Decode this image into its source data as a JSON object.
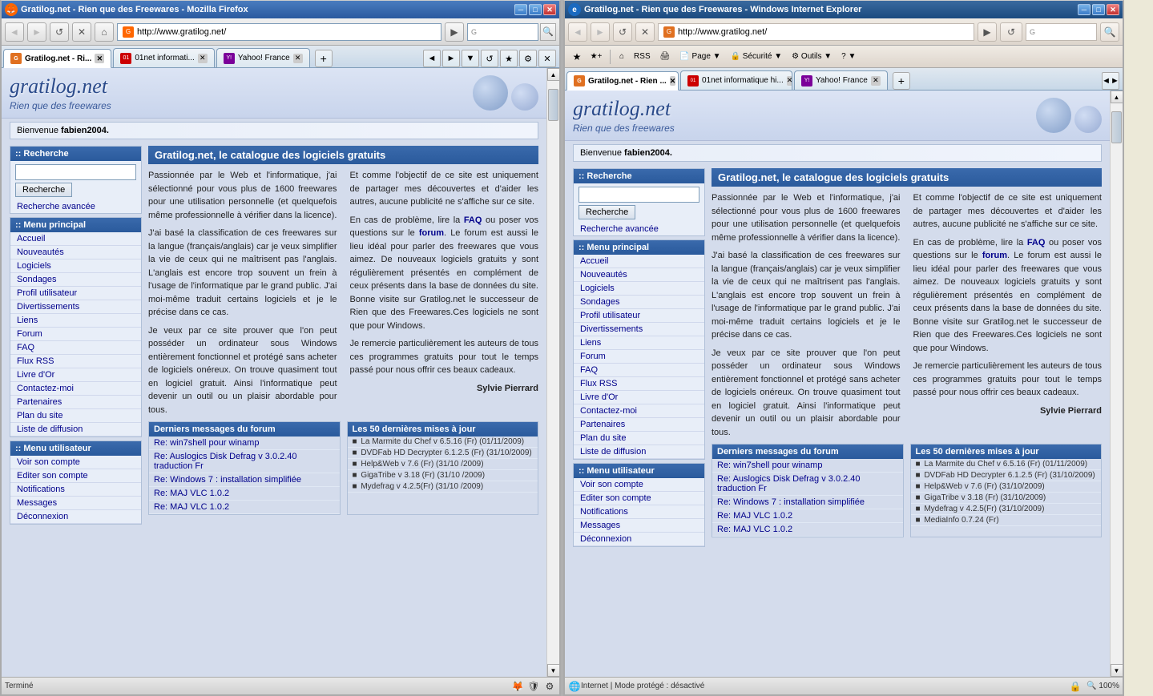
{
  "browsers": [
    {
      "id": "firefox",
      "title": "Gratilog.net - Rien que des Freewares - Mozilla Firefox",
      "type": "firefox",
      "nav": {
        "url": "http://www.gratilog.net/",
        "search_placeholder": "Google"
      },
      "tabs": [
        {
          "id": "tab1",
          "label": "Gratilog.net - Ri...",
          "active": true,
          "favicon_type": "gratilog"
        },
        {
          "id": "tab2",
          "label": "01net informati...",
          "active": false,
          "favicon_type": "zero1"
        },
        {
          "id": "tab3",
          "label": "Yahoo! France",
          "active": false,
          "favicon_type": "yahoo"
        }
      ],
      "status": "Terminé",
      "page": {
        "welcome": "Bienvenue ",
        "welcome_user": "fabien2004.",
        "search_section": ":: Recherche",
        "search_btn": "Recherche",
        "advanced_search": "Recherche avancée",
        "menu_title": ":: Menu principal",
        "menu_items": [
          "Accueil",
          "Nouveautés",
          "Logiciels",
          "Sondages",
          "Profil utilisateur",
          "Divertissements",
          "Liens",
          "Forum",
          "FAQ",
          "Flux RSS",
          "Livre d'Or",
          "Contactez-moi",
          "Partenaires",
          "Plan du site",
          "Liste de diffusion"
        ],
        "user_menu_title": ":: Menu utilisateur",
        "user_menu_items": [
          "Voir son compte",
          "Editer son compte",
          "Notifications",
          "Messages",
          "Déconnexion"
        ],
        "main_title": "Gratilog.net, le catalogue des logiciels gratuits",
        "main_text_col1": "Passionnée par le Web et l'informatique, j'ai sélectionné pour vous plus de 1600 freewares pour une utilisation personnelle (et quelquefois même professionnelle à vérifier dans la licence).\n\nJ'ai basé la classification de ces freewares sur la langue (français/anglais) car je veux simplifier la vie de ceux qui ne maîtrisent pas l'anglais. L'anglais est encore trop souvent un frein à l'usage de l'informatique par le grand public. J'ai moi-même traduit certains logiciels et je le précise dans ce cas.\n\nJe veux par ce site prouver que l'on peut posséder un ordinateur sous Windows entièrement fonctionnel et protégé sans acheter de logiciels onéreux. On trouve quasiment tout en logiciel gratuit. Ainsi l'informatique peut devenir un outil ou un plaisir abordable pour tous.",
        "main_text_col2": "Et comme l'objectif de ce site est uniquement de partager mes découvertes et d'aider les autres, aucune publicité ne s'affiche sur ce site.\n\nEn cas de problème, lire la FAQ ou poser vos questions sur le forum. Le forum est aussi le lieu idéal pour parler des freewares que vous aimez. De nouveaux logiciels gratuits y sont régulièrement présentés en complément de ceux présents dans la base de données du site. Bonne visite sur Gratilog.net le successeur de Rien que des Freewares.Ces logiciels ne sont que pour Windows.\n\nJe remercie particulièrement les auteurs de tous ces programmes gratuits pour tout le temps passé pour nous offrir ces beaux cadeaux.\n\nSylvie Pierrard",
        "forum_title": "Derniers messages du forum",
        "forum_items": [
          "Re: win7shell pour winamp",
          "Re: Auslogics Disk Defrag v 3.0.2.40 traduction Fr",
          "Re: Windows 7 : installation simplifiée",
          "Re: MAJ VLC 1.0.2",
          "Re: MAJ VLC 1.0.2"
        ],
        "updates_title": "Les 50 dernières mises à jour",
        "update_items": [
          "La Marmite du Chef v 6.5.16 (Fr) (01/11/2009)",
          "DVDFab HD Decrypter 6.1.2.5 (Fr) (31/10/2009)",
          "Help&Web v 7.6 (Fr) (31/10 /2009)",
          "GigaTribe v 3.18 (Fr) (31/10 /2009)",
          "Mydefrag v 4.2.5(Fr) (31/10 /2009)"
        ]
      }
    },
    {
      "id": "ie",
      "title": "Gratilog.net - Rien que des Freewares - Windows Internet Explorer",
      "type": "ie",
      "nav": {
        "url": "http://www.gratilog.net/",
        "search_placeholder": "Google"
      },
      "tabs": [
        {
          "id": "tab1",
          "label": "Gratilog.net - Rien ...",
          "active": true,
          "favicon_type": "gratilog"
        },
        {
          "id": "tab2",
          "label": "01net informatique hi...",
          "active": false,
          "favicon_type": "zero1"
        },
        {
          "id": "tab3",
          "label": "Yahoo! France",
          "active": false,
          "favicon_type": "yahoo"
        }
      ],
      "status": "Internet | Mode protégé : désactivé",
      "zoom": "100%",
      "page": {
        "welcome": "Bienvenue ",
        "welcome_user": "fabien2004.",
        "search_section": ":: Recherche",
        "search_btn": "Recherche",
        "advanced_search": "Recherche avancée",
        "menu_title": ":: Menu principal",
        "menu_items": [
          "Accueil",
          "Nouveautés",
          "Logiciels",
          "Sondages",
          "Profil utilisateur",
          "Divertissements",
          "Liens",
          "Forum",
          "FAQ",
          "Flux RSS",
          "Livre d'Or",
          "Contactez-moi",
          "Partenaires",
          "Plan du site",
          "Liste de diffusion"
        ],
        "user_menu_title": ":: Menu utilisateur",
        "user_menu_items": [
          "Voir son compte",
          "Editer son compte",
          "Notifications",
          "Messages",
          "Déconnexion"
        ],
        "main_title": "Gratilog.net, le catalogue des logiciels gratuits",
        "forum_title": "Derniers messages du forum",
        "forum_items": [
          "Re: win7shell pour winamp",
          "Re: Auslogics Disk Defrag v 3.0.2.40 traduction Fr",
          "Re: Windows 7 : installation simplifiée",
          "Re: MAJ VLC 1.0.2",
          "Re: MAJ VLC 1.0.2"
        ],
        "updates_title": "Les 50 dernières mises à jour",
        "update_items": [
          "La Marmite du Chef v 6.5.16 (Fr) (01/11/2009)",
          "DVDFab HD Decrypter 6.1.2.5 (Fr) (31/10/2009)",
          "Help&Web v 7.6 (Fr) (31/10/2009)",
          "GigaTribe v 3.18 (Fr) (31/10/2009)",
          "Mydefrag v 4.2.5(Fr) (31/10/2009)",
          "MediaInfo 0.7.24 (Fr)"
        ]
      }
    }
  ],
  "icons": {
    "back": "◄",
    "forward": "►",
    "refresh": "↺",
    "stop": "✕",
    "home": "⌂",
    "search": "🔍",
    "close": "✕",
    "minimize": "─",
    "maximize": "□",
    "scroll_up": "▲",
    "scroll_down": "▼",
    "new_tab": "+"
  }
}
